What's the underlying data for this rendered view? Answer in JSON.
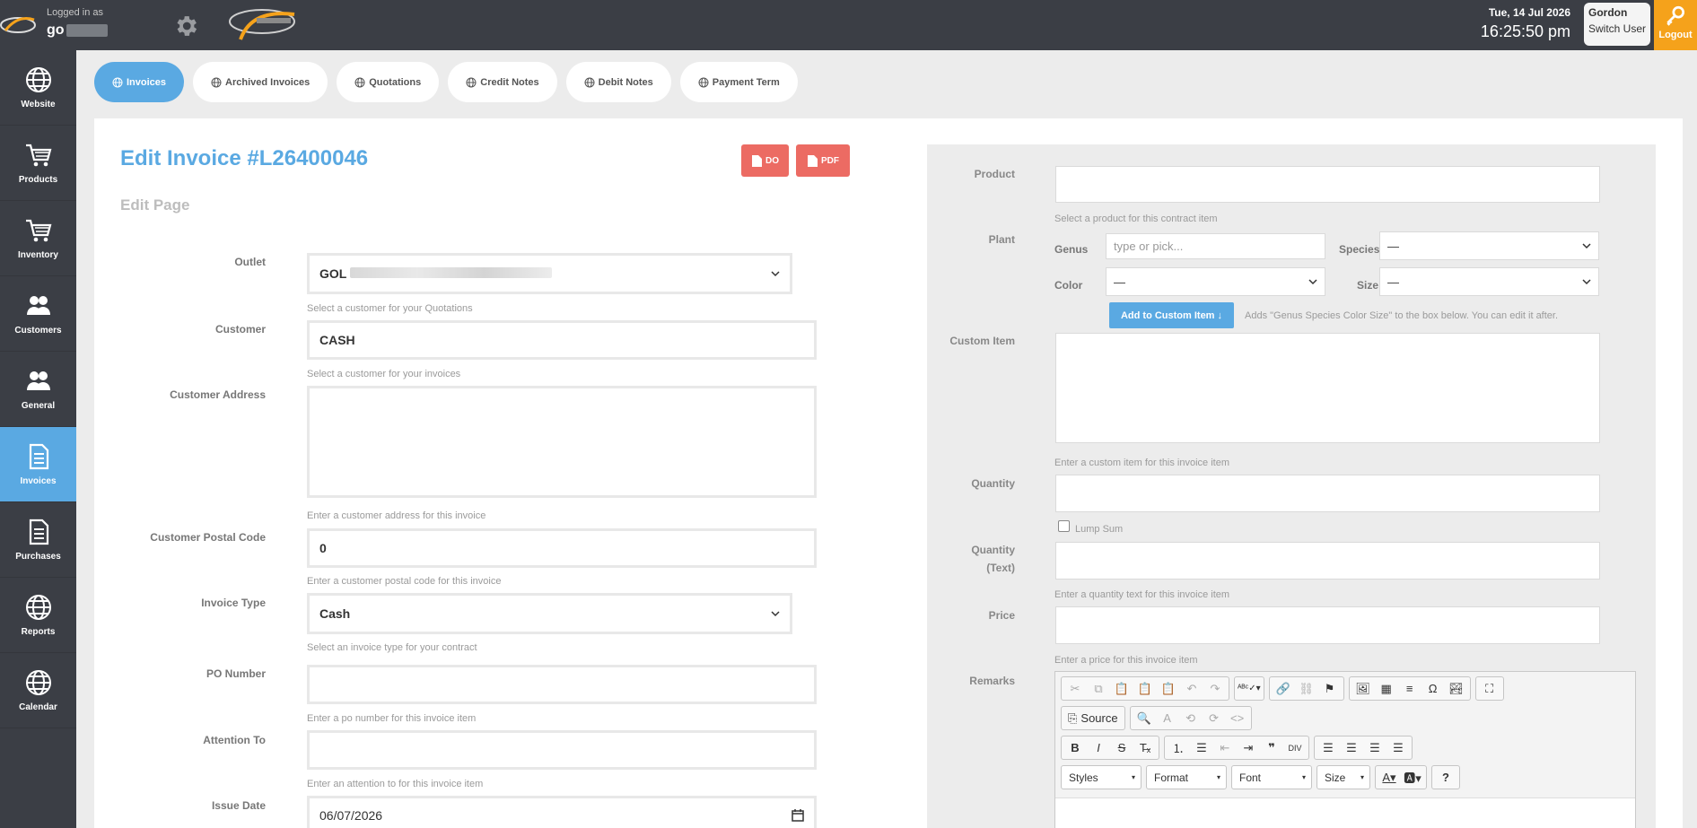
{
  "header": {
    "logged_in_as": "Logged in as",
    "username_prefix": "go",
    "date": "Tue, 14 Jul 2026",
    "time": "16:25:50 pm",
    "user_name": "Gordon",
    "switch_user": "Switch User",
    "logout": "Logout"
  },
  "sidebar": {
    "items": [
      {
        "label": "Website",
        "icon": "globe-icon"
      },
      {
        "label": "Products",
        "icon": "cart-icon"
      },
      {
        "label": "Inventory",
        "icon": "cart-icon"
      },
      {
        "label": "Customers",
        "icon": "users-icon"
      },
      {
        "label": "General",
        "icon": "users-icon"
      },
      {
        "label": "Invoices",
        "icon": "document-icon"
      },
      {
        "label": "Purchases",
        "icon": "document-icon"
      },
      {
        "label": "Reports",
        "icon": "globe-icon"
      },
      {
        "label": "Calendar",
        "icon": "globe-icon"
      }
    ],
    "active": "Invoices"
  },
  "tabs": [
    {
      "label": "Invoices"
    },
    {
      "label": "Archived Invoices"
    },
    {
      "label": "Quotations"
    },
    {
      "label": "Credit Notes"
    },
    {
      "label": "Debit Notes"
    },
    {
      "label": "Payment Term"
    }
  ],
  "page": {
    "title": "Edit Invoice #L26400046",
    "subtitle": "Edit Page",
    "do_button": "DO",
    "pdf_button": "PDF"
  },
  "form": {
    "outlet": {
      "label": "Outlet",
      "value_prefix": "GOL",
      "help": "Select a customer for your Quotations"
    },
    "customer": {
      "label": "Customer",
      "value": "CASH",
      "help": "Select a customer for your invoices"
    },
    "customer_address": {
      "label": "Customer Address",
      "value": "",
      "help": "Enter a customer address for this invoice"
    },
    "customer_postal_code": {
      "label": "Customer Postal Code",
      "value": "0",
      "help": "Enter a customer postal code for this invoice"
    },
    "invoice_type": {
      "label": "Invoice Type",
      "value": "Cash",
      "help": "Select an invoice type for your contract"
    },
    "po_number": {
      "label": "PO Number",
      "value": "",
      "help": "Enter a po number for this invoice item"
    },
    "attention_to": {
      "label": "Attention To",
      "value": "",
      "help": "Enter an attention to for this invoice item"
    },
    "issue_date": {
      "label": "Issue Date",
      "value": "06/07/2026"
    }
  },
  "item": {
    "product": {
      "label": "Product",
      "help": "Select a product for this contract item"
    },
    "plant": {
      "label": "Plant",
      "genus_label": "Genus",
      "genus_placeholder": "type or pick...",
      "species_label": "Species",
      "species_value": "—",
      "color_label": "Color",
      "color_value": "—",
      "size_label": "Size",
      "size_value": "—",
      "add_button": "Add to Custom Item ↓",
      "add_help": "Adds \"Genus Species Color Size\" to the box below. You can edit it after."
    },
    "custom_item": {
      "label": "Custom Item",
      "help": "Enter a custom item for this invoice item"
    },
    "quantity": {
      "label": "Quantity",
      "lump_sum": "Lump Sum"
    },
    "quantity_text": {
      "label_line1": "Quantity",
      "label_line2": "(Text)",
      "help": "Enter a quantity text for this invoice item"
    },
    "price": {
      "label": "Price",
      "help": "Enter a price for this invoice item"
    },
    "remarks": {
      "label": "Remarks",
      "source_label": "Source",
      "styles": "Styles",
      "format": "Format",
      "font": "Font",
      "size": "Size",
      "help_btn": "?"
    }
  }
}
